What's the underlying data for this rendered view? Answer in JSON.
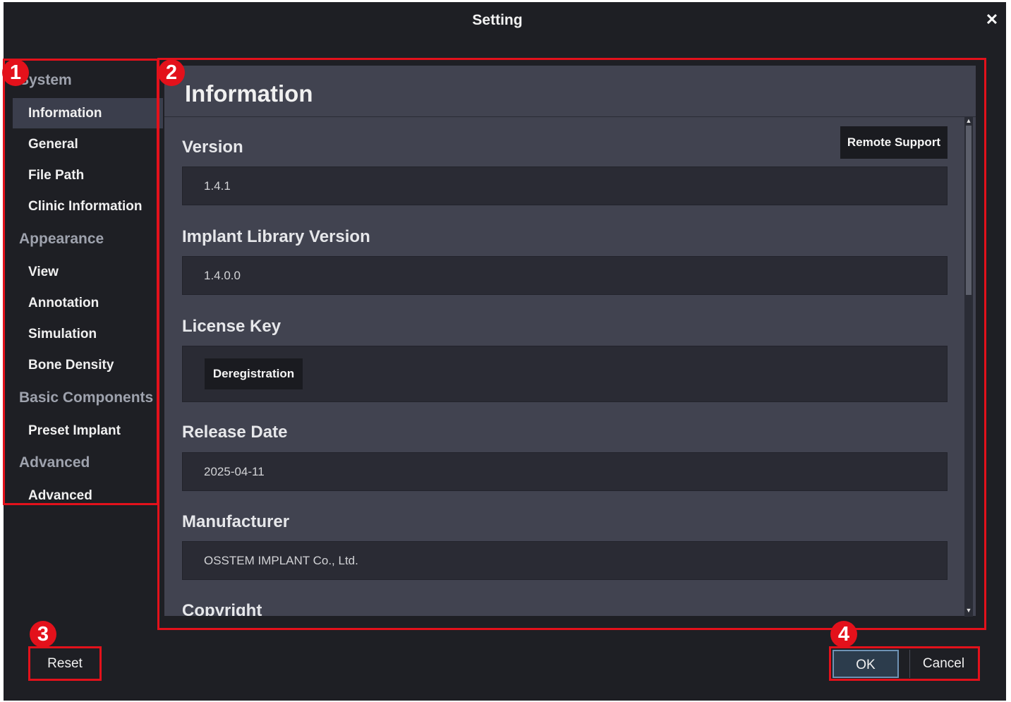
{
  "window": {
    "title": "Setting",
    "close_icon": "close-icon"
  },
  "sidebar": {
    "categories": [
      "System",
      "Appearance",
      "Basic Components",
      "Advanced"
    ],
    "items": [
      "Information",
      "General",
      "File Path",
      "Clinic Information",
      "View",
      "Annotation",
      "Simulation",
      "Bone Density",
      "Preset Implant",
      "Advanced"
    ],
    "selected": "Information"
  },
  "panel": {
    "title": "Information",
    "remote_support_label": "Remote Support",
    "fields": [
      {
        "label": "Version",
        "value": "1.4.1"
      },
      {
        "label": "Implant Library Version",
        "value": "1.4.0.0"
      },
      {
        "label": "License Key",
        "button": "Deregistration"
      },
      {
        "label": "Release Date",
        "value": "2025-04-11"
      },
      {
        "label": "Manufacturer",
        "value": "OSSTEM IMPLANT Co., Ltd."
      },
      {
        "label": "Copyright"
      }
    ]
  },
  "footer": {
    "reset_label": "Reset",
    "ok_label": "OK",
    "cancel_label": "Cancel"
  },
  "callouts": [
    "1",
    "2",
    "3",
    "4"
  ],
  "colors": {
    "accent_red": "#e3111b",
    "background": "#1e1f24",
    "panel": "#414350",
    "selected_item": "#3b3e4c"
  }
}
